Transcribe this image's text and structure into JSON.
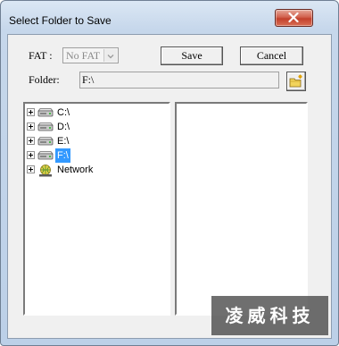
{
  "window": {
    "title": "Select Folder to Save"
  },
  "form": {
    "fat_label": "FAT :",
    "fat_value": "No FAT",
    "save_label": "Save",
    "cancel_label": "Cancel",
    "folder_label": "Folder:",
    "folder_value": "F:\\"
  },
  "tree": {
    "items": [
      {
        "label": "C:\\",
        "icon": "drive-icon",
        "selected": false
      },
      {
        "label": "D:\\",
        "icon": "drive-icon",
        "selected": false
      },
      {
        "label": "E:\\",
        "icon": "drive-icon",
        "selected": false
      },
      {
        "label": "F:\\",
        "icon": "drive-icon",
        "selected": true
      },
      {
        "label": "Network",
        "icon": "network-icon",
        "selected": false
      }
    ]
  },
  "watermark": {
    "text": "凌威科技"
  },
  "colors": {
    "selection": "#3399ff",
    "close_button": "#c3412c",
    "dialog_face": "#f0f0f0"
  }
}
